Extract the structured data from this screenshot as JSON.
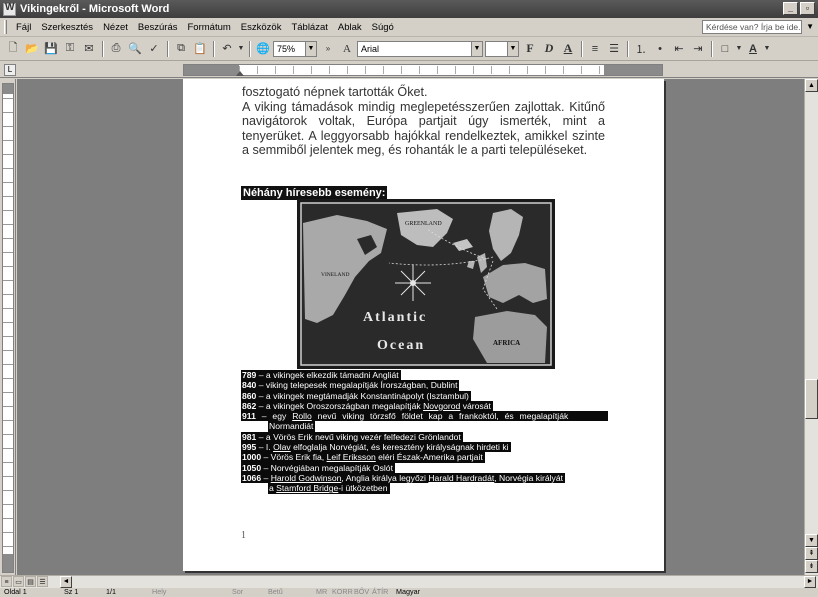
{
  "window": {
    "title": "Vikingekről - Microsoft Word",
    "min": "_",
    "restore": "▫",
    "close": "×"
  },
  "menu": {
    "items": [
      "Fájl",
      "Szerkesztés",
      "Nézet",
      "Beszúrás",
      "Formátum",
      "Eszközök",
      "Táblázat",
      "Ablak",
      "Súgó"
    ],
    "help_placeholder": "Kérdése van? Írja be ide."
  },
  "toolbar": {
    "zoom": "75%",
    "font": "Arial",
    "size": "",
    "bold": "F",
    "italic": "D",
    "underline": "A"
  },
  "document": {
    "paragraph_lines": [
      "fosztogató népnek tartották Őket.",
      "A viking támadások mindig meglepetésszerűen zajlottak. Kitűnő navigátorok voltak, Európa partjait úgy ismerték, mint a tenyerüket. A leggyorsabb hajókkal rendelkeztek, amikkel szinte a semmiből jelentek meg, és rohanták le a parti településeket."
    ],
    "heading": "Néhány híresebb esemény:",
    "map_labels": {
      "greenland": "GREENLAND",
      "vineland": "VINELAND",
      "atlantic": "Atlantic",
      "ocean": "Ocean",
      "africa": "AFRICA"
    },
    "events": [
      {
        "year": "789",
        "text": " – a vikingek elkezdik támadni Angliát"
      },
      {
        "year": "840",
        "text": " – viking telepesek megalapítják Írországban, Dublint"
      },
      {
        "year": "860",
        "text": " – a vikingek megtámadják Konstantinápolyt (Isztambul)"
      },
      {
        "year": "862",
        "text_pre": " – a vikingek Oroszországban megalapítják ",
        "link": "Novgorod",
        "text_post": " városát"
      },
      {
        "year": "911",
        "text_pre": " – egy ",
        "link": "Rollo",
        "text_post": " nevű viking törzsfő földet kap a frankoktól, és megalapítják"
      },
      {
        "cont": "Normandiát"
      },
      {
        "year": "981",
        "text": " – a Vörös Erik nevű viking vezér felfedezi Grönlandot"
      },
      {
        "year": "995",
        "text_pre": " – I. ",
        "link": "Olav",
        "text_post": " elfoglalja Norvégiát, és keresztény királyságnak hirdeti ki"
      },
      {
        "year": "1000",
        "text_pre": " – Vörös Erik fia, ",
        "link": "Leif Eriksson",
        "text_post": " eléri Észak-Amerika partjait"
      },
      {
        "year": "1050",
        "text": " – Norvégiában megalapítják Oslót"
      },
      {
        "year": "1066",
        "text_pre": " – ",
        "link": "Harold Godwinson",
        "text_mid": ", Anglia királya legyőzi ",
        "link2": "Harald Hardradát",
        "text_post": ", Norvégia királyát"
      },
      {
        "cont_pre": "a ",
        "cont_link": "Stamford Bridge",
        "cont_post": "-i ütközetben"
      }
    ],
    "page_number": "1"
  },
  "status": {
    "page": "Oldal 1",
    "section": "Sz 1",
    "pages": "1/1",
    "at": "Hely",
    "line": "Sor",
    "col": "Betű",
    "rec": "MR",
    "trk": "KORR",
    "ext": "BŐV",
    "ovr": "ÁTÍR",
    "lang": "Magyar"
  }
}
